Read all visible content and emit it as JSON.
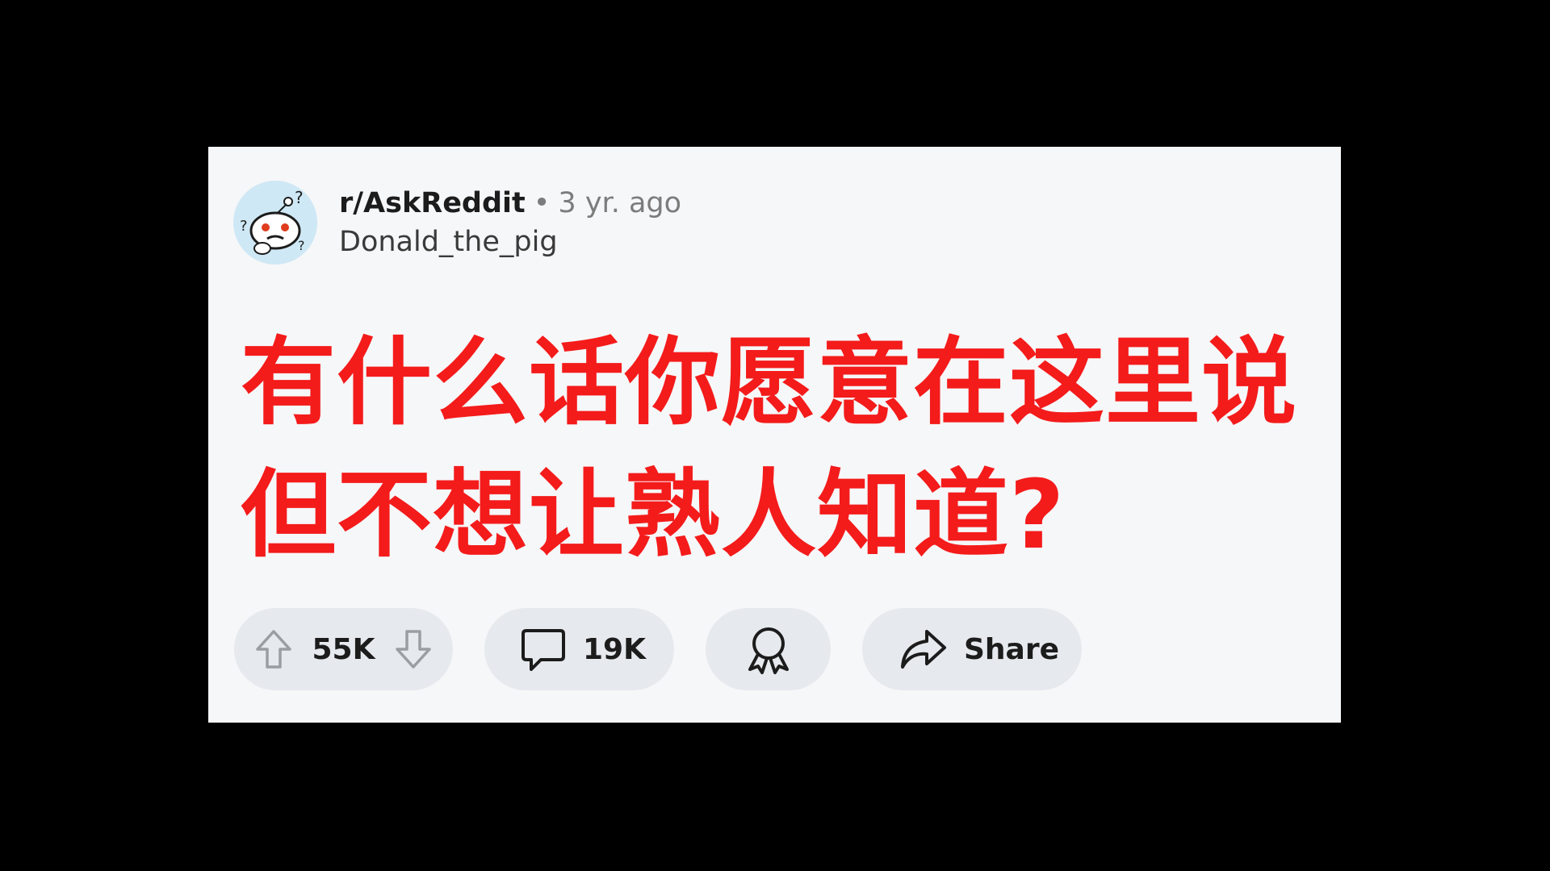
{
  "post": {
    "subreddit": "r/AskReddit",
    "separator": "•",
    "time_ago": "3 yr. ago",
    "author": "Donald_the_pig",
    "avatar_icon": "snoo-question-avatar-icon",
    "title_lines": [
      "有什么话你愿意在这里说",
      "但不想让熟人知道?"
    ]
  },
  "actions": {
    "upvote_icon": "upvote-arrow-icon",
    "vote_count": "55K",
    "downvote_icon": "downvote-arrow-icon",
    "comment_icon": "comment-bubble-icon",
    "comment_count": "19K",
    "award_icon": "award-ribbon-icon",
    "share_icon": "share-arrow-icon",
    "share_label": "Share"
  },
  "colors": {
    "page_background": "#000000",
    "card_background": "#f6f7f8",
    "title_color": "#f41b1b",
    "pill_background": "#e6e9ed",
    "meta_gray": "#7c7c7c"
  }
}
